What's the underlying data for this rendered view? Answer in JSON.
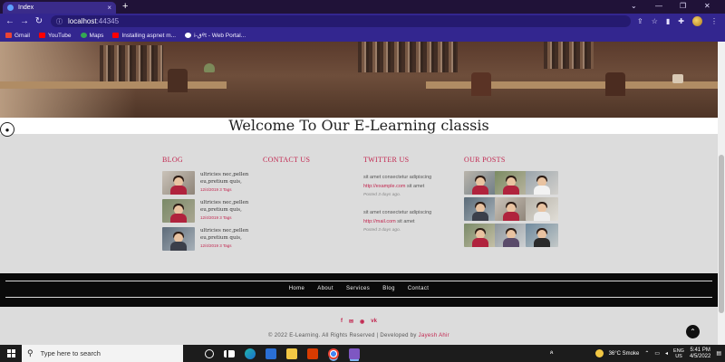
{
  "browser": {
    "tab_title": "Index",
    "tab_close": "×",
    "new_tab": "+",
    "window_controls": [
      "⌄",
      "—",
      "❐",
      "✕"
    ],
    "url_host": "localhost",
    "url_port": ":44345",
    "bookmarks": [
      {
        "label": "Gmail",
        "color": "#ea4335"
      },
      {
        "label": "YouTube",
        "color": "#ff0000"
      },
      {
        "label": "Maps",
        "color": "#34a853"
      },
      {
        "label": "Installing aspnet m...",
        "color": "#ff0000"
      },
      {
        "label": "i-ق୧t - Web Portal...",
        "color": "#ffffff"
      }
    ]
  },
  "page": {
    "welcome": "Welcome To Our E-Learning classis",
    "blog": {
      "heading": "BLOG",
      "items": [
        {
          "title": "ultricies nec,pellen eu,pretium quis,",
          "date": "12/4/2019",
          "tags": "3 Tags"
        },
        {
          "title": "ultricies nec,pellen eu,pretium quis,",
          "date": "12/4/2019",
          "tags": "3 Tags"
        },
        {
          "title": "ultricies nec,pellen eu,pretium quis,",
          "date": "12/4/2019",
          "tags": "3 Tags"
        }
      ]
    },
    "contact": {
      "heading": "CONTACT US"
    },
    "twitter": {
      "heading": "TWITTER US",
      "tweets": [
        {
          "text": "sit amet consectetur adipiscing",
          "link": "http://example.com",
          "after": " sit amet",
          "posted": "Posted 3 days ago."
        },
        {
          "text": "sit amet consectetur adipiscing",
          "link": "http://mail.com",
          "after": " sit amet",
          "posted": "Posted 3 days ago."
        }
      ]
    },
    "posts": {
      "heading": "OUR POSTS"
    },
    "footer_nav": [
      "Home",
      "About",
      "Services",
      "Blog",
      "Contact"
    ],
    "social": [
      "f",
      "✉",
      "◉",
      "vk"
    ],
    "copyright_prefix": "© 2022 E-Learning. All Rights Reserved | Developed by ",
    "copyright_author": "Jayesh Ahir",
    "accent_color": "#c2264f"
  },
  "taskbar": {
    "search_placeholder": "Type here to search",
    "weather": "36°C  Smoke",
    "lang_line1": "ENG",
    "lang_line2": "US",
    "time": "5:41 PM",
    "date": "4/5/2022"
  }
}
